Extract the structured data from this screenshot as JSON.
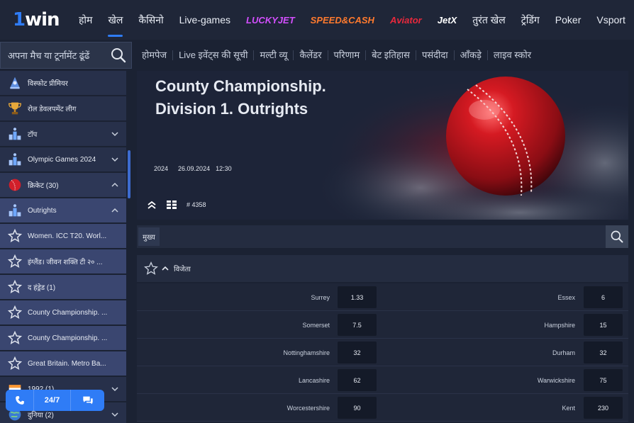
{
  "brand": {
    "logo_prefix": "1",
    "logo_suffix": "win"
  },
  "nav": {
    "items": [
      {
        "label": "होम"
      },
      {
        "label": "खेल",
        "active": true
      },
      {
        "label": "कैसिनो"
      },
      {
        "label": "Live-games"
      },
      {
        "label": "LUCKYJET",
        "brand": true,
        "color": "#d44fff"
      },
      {
        "label": "SPEED&CASH",
        "brand": true,
        "color": "#ff7a2e"
      },
      {
        "label": "Aviator",
        "brand": true,
        "color": "#e8283c"
      },
      {
        "label": "JetX",
        "brand": true,
        "color": "#ffffff"
      },
      {
        "label": "तुरंत खेल"
      },
      {
        "label": "ट्रेडिंग"
      },
      {
        "label": "Poker"
      },
      {
        "label": "Vsport"
      }
    ]
  },
  "search": {
    "placeholder": "अपना मैच या टूर्नामेंट ढूंढें"
  },
  "subnav": {
    "items": [
      "होमपेज",
      "Live इवेंट्स की सूची",
      "मल्टी व्यू",
      "कैलेंडर",
      "परिणाम",
      "बेट इतिहास",
      "पसंदीदा",
      "आँकड़े",
      "लाइव स्कोर"
    ]
  },
  "sidebar": {
    "items": [
      {
        "label": "विस्फोट प्रीमियर",
        "icon": "trophy-blue-icon",
        "style": "dark",
        "chevron": false
      },
      {
        "label": "रोल डेवलपमेंट लीग",
        "icon": "trophy-gold-icon",
        "style": "dark",
        "chevron": false
      },
      {
        "label": "टॉप",
        "icon": "podium-icon",
        "style": "dark",
        "chevron": "down"
      },
      {
        "label": "Olympic Games 2024",
        "icon": "podium-icon",
        "style": "dark",
        "chevron": "down"
      },
      {
        "label": "क्रिकेट (30)",
        "icon": "cricket-ball-icon",
        "style": "mid",
        "chevron": "up"
      },
      {
        "label": "Outrights",
        "icon": "podium-icon",
        "style": "light",
        "chevron": "up"
      },
      {
        "label": "Women. ICC T20. Worl...",
        "icon": "star-icon",
        "style": "light",
        "chevron": false
      },
      {
        "label": "इंग्लैंड। जीवन शक्ति टी २० ...",
        "icon": "star-icon",
        "style": "light",
        "chevron": false
      },
      {
        "label": "द हंड्रेड (1)",
        "icon": "star-icon",
        "style": "light",
        "chevron": false
      },
      {
        "label": "County Championship. ...",
        "icon": "star-icon",
        "style": "light",
        "chevron": false
      },
      {
        "label": "County Championship. ...",
        "icon": "star-icon",
        "style": "light",
        "chevron": false
      },
      {
        "label": "Great Britain. Metro Ba...",
        "icon": "star-icon",
        "style": "light",
        "chevron": false
      },
      {
        "label": "1992 (1)",
        "icon": "flag-icon",
        "style": "dark",
        "chevron": "down"
      },
      {
        "label": "दुनिया (2)",
        "icon": "globe-icon",
        "style": "dark",
        "chevron": "down"
      }
    ]
  },
  "support": {
    "label_247": "24/7"
  },
  "hero": {
    "title_line1": "County Championship.",
    "title_line2": "Division 1. Outrights",
    "year": "2024",
    "date": "26.09.2024",
    "time": "12:30",
    "event_id": "# 4358"
  },
  "tabs": {
    "main": "मुख्य"
  },
  "market": {
    "name": "विजेता",
    "rows": [
      {
        "left_team": "Surrey",
        "left_odd": "1.33",
        "right_team": "Essex",
        "right_odd": "6"
      },
      {
        "left_team": "Somerset",
        "left_odd": "7.5",
        "right_team": "Hampshire",
        "right_odd": "15"
      },
      {
        "left_team": "Nottinghamshire",
        "left_odd": "32",
        "right_team": "Durham",
        "right_odd": "32"
      },
      {
        "left_team": "Lancashire",
        "left_odd": "62",
        "right_team": "Warwickshire",
        "right_odd": "75"
      },
      {
        "left_team": "Worcestershire",
        "left_odd": "90",
        "right_team": "Kent",
        "right_odd": "230"
      }
    ]
  },
  "colors": {
    "accent": "#2f7cf6",
    "background": "#1b2233"
  }
}
